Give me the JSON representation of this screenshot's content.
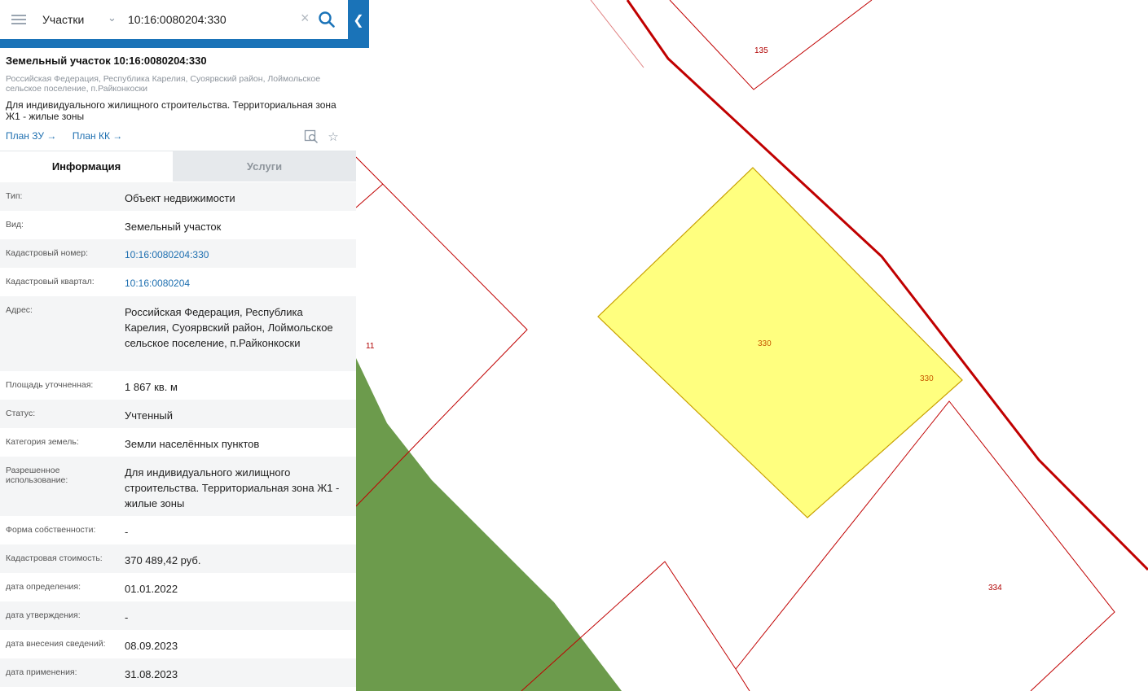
{
  "search": {
    "type_label": "Участки",
    "query": "10:16:0080204:330"
  },
  "header": {
    "title": "Земельный участок 10:16:0080204:330",
    "address": "Российская Федерация, Республика Карелия, Суоярвский район, Лоймольское сельское поселение, п.Райконкоски",
    "purpose": "Для индивидуального жилищного строительства. Территориальная зона Ж1 - жилые зоны",
    "links": [
      "План ЗУ →",
      "План КК →"
    ]
  },
  "tabs": [
    "Информация",
    "Услуги"
  ],
  "rows": [
    {
      "label": "Тип:",
      "value": "Объект недвижимости"
    },
    {
      "label": "Вид:",
      "value": "Земельный участок"
    },
    {
      "label": "Кадастровый номер:",
      "value": "10:16:0080204:330"
    },
    {
      "label": "Кадастровый квартал:",
      "value": "10:16:0080204"
    },
    {
      "label": "Адрес:",
      "value": "Российская Федерация, Республика Карелия, Суоярвский район, Лоймольское сельское поселение, п.Райконкоски"
    },
    {
      "label": "Площадь уточненная:",
      "value": "1 867 кв. м"
    },
    {
      "label": "Статус:",
      "value": "Учтенный"
    },
    {
      "label": "Категория земель:",
      "value": "Земли населённых пунктов"
    },
    {
      "label": "Разрешенное использование:",
      "value": "Для индивидуального жилищного строительства. Территориальная зона Ж1 - жилые зоны"
    },
    {
      "label": "Форма собственности:",
      "value": "-"
    },
    {
      "label": "Кадастровая стоимость:",
      "value": "370 489,42 руб."
    },
    {
      "label": "дата определения:",
      "value": "01.01.2022"
    },
    {
      "label": "дата утверждения:",
      "value": "-"
    },
    {
      "label": "дата внесения сведений:",
      "value": "08.09.2023"
    },
    {
      "label": "дата применения:",
      "value": "31.08.2023"
    }
  ],
  "map": {
    "labels": [
      "135",
      "11",
      "330",
      "330",
      "334"
    ],
    "colors": {
      "parcel_border": "#c00000",
      "selected_fill": "#ffff7f",
      "forest": "#6c9b4c"
    }
  }
}
